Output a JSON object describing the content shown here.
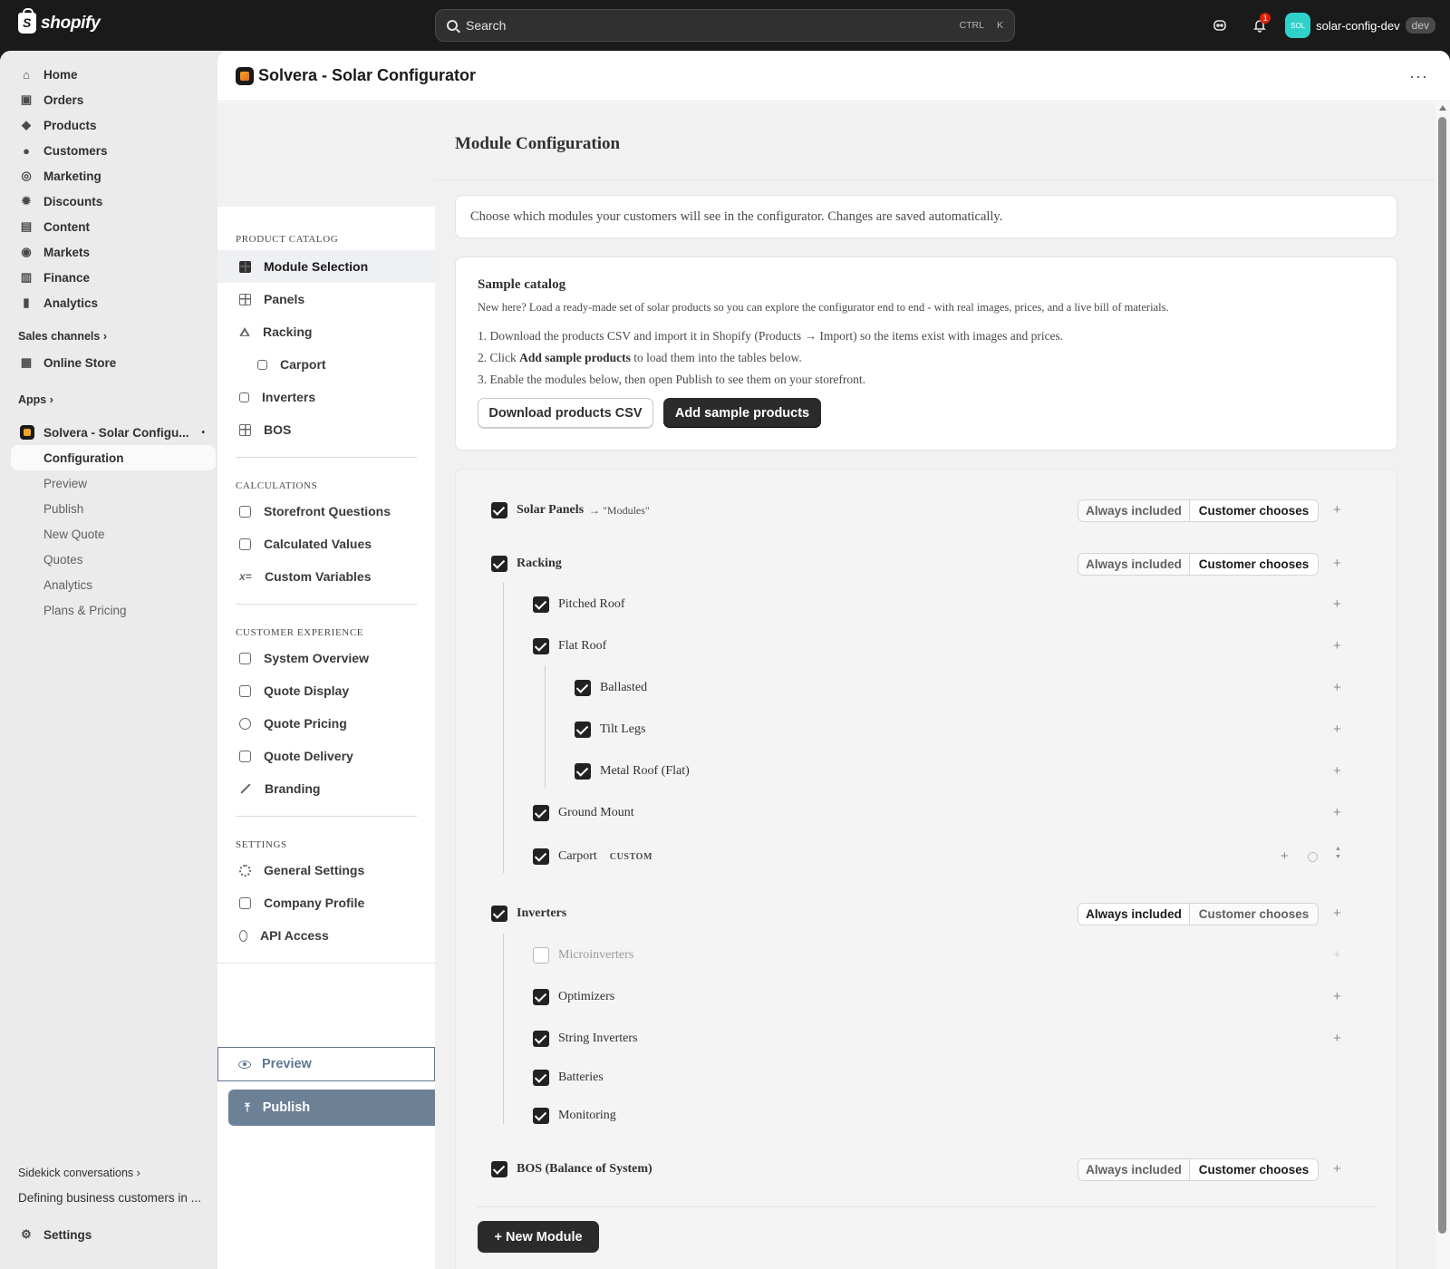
{
  "topbar": {
    "logo_text": "shopify",
    "search_placeholder": "Search",
    "shortcut_ctrl": "CTRL",
    "shortcut_key": "K",
    "notification_count": "1",
    "store_avatar": "SOL",
    "store_name": "solar-config-dev",
    "env_badge": "dev"
  },
  "admin_nav": {
    "items": [
      {
        "label": "Home",
        "icon": "home-icon"
      },
      {
        "label": "Orders",
        "icon": "inbox-icon"
      },
      {
        "label": "Products",
        "icon": "tag-icon"
      },
      {
        "label": "Customers",
        "icon": "person-icon"
      },
      {
        "label": "Marketing",
        "icon": "target-icon"
      },
      {
        "label": "Discounts",
        "icon": "discount-icon"
      },
      {
        "label": "Content",
        "icon": "image-icon"
      },
      {
        "label": "Markets",
        "icon": "globe-icon"
      },
      {
        "label": "Finance",
        "icon": "bank-icon"
      },
      {
        "label": "Analytics",
        "icon": "bar-chart-icon"
      }
    ],
    "sales_channels_label": "Sales channels",
    "online_store_label": "Online Store",
    "apps_label": "Apps",
    "app_name": "Solvera - Solar Configu...",
    "app_subitems": [
      "Configuration",
      "Preview",
      "Publish",
      "New Quote",
      "Quotes",
      "Analytics",
      "Plans & Pricing"
    ],
    "sidekick_label": "Sidekick conversations",
    "sidekick_recent": "Defining business customers in ...",
    "settings_label": "Settings"
  },
  "app_header": {
    "title": "Solvera - Solar Configurator",
    "more": "···"
  },
  "config_nav": {
    "sections": [
      "PRODUCT CATALOG",
      "CALCULATIONS",
      "CUSTOMER EXPERIENCE",
      "SETTINGS"
    ],
    "product_catalog": [
      "Module Selection",
      "Panels",
      "Racking",
      "Carport",
      "Inverters",
      "BOS"
    ],
    "calculations": [
      "Storefront Questions",
      "Calculated Values",
      "Custom Variables"
    ],
    "customer_experience": [
      "System Overview",
      "Quote Display",
      "Quote Pricing",
      "Quote Delivery",
      "Branding"
    ],
    "settings": [
      "General Settings",
      "Company Profile",
      "API Access"
    ],
    "preview_label": "Preview",
    "publish_label": "Publish"
  },
  "content": {
    "title": "Module Configuration",
    "intro": "Choose which modules your customers will see in the configurator. Changes are saved automatically.",
    "sample": {
      "heading": "Sample catalog",
      "description": "New here? Load a ready-made set of solar products so you can explore the configurator end to end - with real images, prices, and a live bill of materials.",
      "step1": "1. Download the products CSV and import it in Shopify (Products → Import) so the items exist with images and prices.",
      "step2_prefix": "2. Click ",
      "step2_bold": "Add sample products",
      "step2_suffix": " to load them into the tables below.",
      "step3": "3. Enable the modules below, then open Publish to see them on your storefront.",
      "download_button": "Download products CSV",
      "add_button": "Add sample products"
    },
    "toggle_always": "Always included",
    "toggle_customer": "Customer chooses",
    "plus": "+",
    "modules": {
      "solar_panels": {
        "label": "Solar Panels",
        "alias": "→ \"Modules\"",
        "checked": true,
        "mode": "Customer chooses"
      },
      "racking": {
        "label": "Racking",
        "checked": true,
        "mode": "Customer chooses"
      },
      "racking_children": [
        "Pitched Roof",
        "Flat Roof",
        "Ground Mount",
        "Carport"
      ],
      "flat_roof_children": [
        "Ballasted",
        "Tilt Legs",
        "Metal Roof (Flat)"
      ],
      "carport_badge": "CUSTOM",
      "inverters": {
        "label": "Inverters",
        "checked": true,
        "mode": "Always included"
      },
      "inverters_children": [
        {
          "label": "Microinverters",
          "checked": false
        },
        {
          "label": "Optimizers",
          "checked": true
        },
        {
          "label": "String Inverters",
          "checked": true
        },
        {
          "label": "Batteries",
          "checked": true
        },
        {
          "label": "Monitoring",
          "checked": true
        }
      ],
      "bos": {
        "label": "BOS (Balance of System)",
        "checked": true,
        "mode": "Customer chooses"
      }
    },
    "new_module_button": "+ New Module"
  }
}
